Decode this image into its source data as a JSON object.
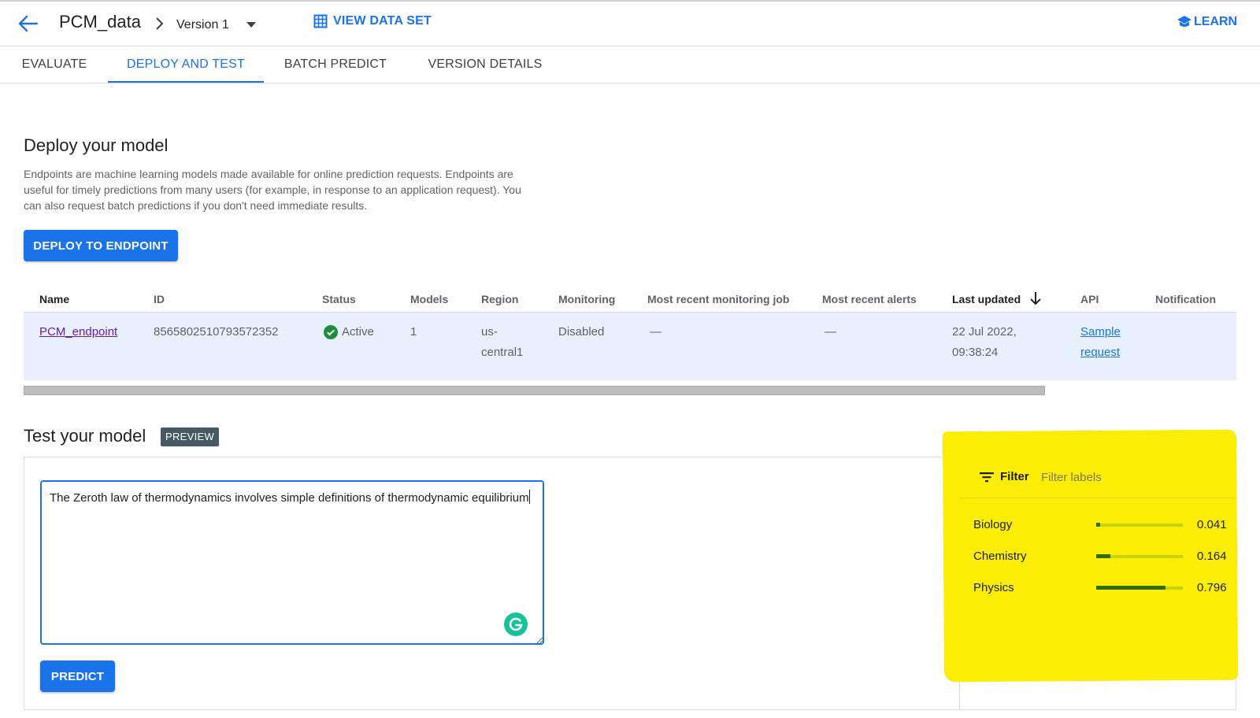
{
  "header": {
    "model_name": "PCM_data",
    "version": "Version 1",
    "view_dataset": "VIEW DATA SET",
    "learn": "LEARN"
  },
  "tabs": [
    {
      "label": "EVALUATE",
      "active": false
    },
    {
      "label": "DEPLOY AND TEST",
      "active": true
    },
    {
      "label": "BATCH PREDICT",
      "active": false
    },
    {
      "label": "VERSION DETAILS",
      "active": false
    }
  ],
  "deploy": {
    "title": "Deploy your model",
    "description": "Endpoints are machine learning models made available for online prediction requests. Endpoints are useful for timely predictions from many users (for example, in response to an application request). You can also request batch predictions if you don't need immediate results.",
    "button": "DEPLOY TO ENDPOINT"
  },
  "table": {
    "headers": [
      "Name",
      "ID",
      "Status",
      "Models",
      "Region",
      "Monitoring",
      "Most recent monitoring job",
      "Most recent alerts",
      "Last updated",
      "API",
      "Notification"
    ],
    "row": {
      "name": "PCM_endpoint",
      "id": "8565802510793572352",
      "status": "Active",
      "models": "1",
      "region_line1": "us-",
      "region_line2": "central1",
      "monitoring": "Disabled",
      "recent_job": "—",
      "recent_alerts": "—",
      "updated_line1": "22 Jul 2022,",
      "updated_line2": "09:38:24",
      "api_line1": "Sample",
      "api_line2": "request",
      "notification": ""
    }
  },
  "test": {
    "title": "Test your model",
    "badge": "PREVIEW",
    "input_text": "The Zeroth law of thermodynamics involves simple definitions of thermodynamic equilibrium",
    "predict": "PREDICT"
  },
  "results": {
    "filter_label": "Filter",
    "filter_placeholder": "Filter labels",
    "labels": [
      {
        "name": "Biology",
        "score": "0.041",
        "value": 0.041
      },
      {
        "name": "Chemistry",
        "score": "0.164",
        "value": 0.164
      },
      {
        "name": "Physics",
        "score": "0.796",
        "value": 0.796
      }
    ]
  },
  "colors": {
    "accent": "#1a73e8",
    "active_status": "#1e8e3e",
    "highlight": "#fbed06",
    "bar_fill": "#2e6b00",
    "bar_track": "#c8d400"
  }
}
